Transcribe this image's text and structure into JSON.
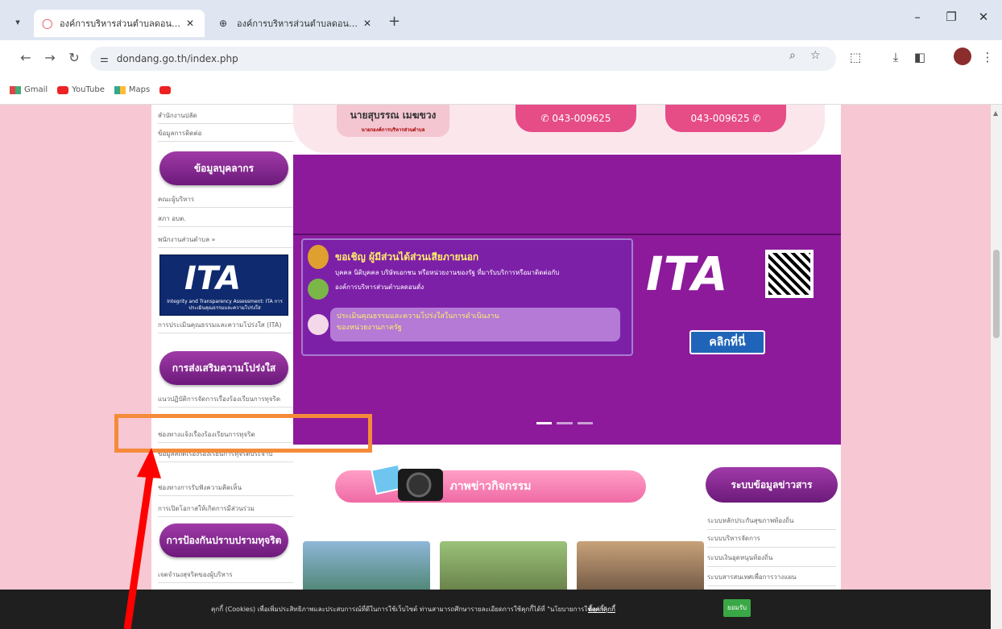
{
  "browser": {
    "tabs": [
      {
        "title": "องค์การบริหารส่วนตำบลดอนดั่ง อำเ...",
        "active": true
      },
      {
        "title": "องค์การบริหารส่วนตำบลดอนดั่ง อำเ...",
        "active": false
      }
    ],
    "url": "dondang.go.th/index.php",
    "bookmarks": [
      "Gmail",
      "YouTube",
      "Maps"
    ]
  },
  "colors": {
    "page_bg": "#f7c7d3",
    "purple": "#8d1a9b",
    "pink": "#e64c86",
    "annotation_box": "#f58b3a",
    "annotation_arrow": "#ff0000"
  },
  "sidebar": {
    "top_links": [
      "สำนักงานปลัด",
      "ข้อมูลการติดต่อ"
    ],
    "personnel_heading": "ข้อมูลบุคลากร",
    "personnel_links": [
      "คณะผู้บริหาร",
      "สภา อบต.",
      "พนักงานส่วนตำบล »"
    ],
    "ita": {
      "logo": "ITA",
      "caption": "Integrity and Transparency Assessment: ITA การประเมินคุณธรรมและความโปร่งใส",
      "link": "การประเมินคุณธรรมและความโปร่งใส (ITA)"
    },
    "transparency_heading": "การส่งเสริมความโปร่งใส",
    "transparency_links": [
      "แนวปฏิบัติการจัดการเรื่องร้องเรียนการทุจริต",
      "ช่องทางแจ้งเรื่องร้องเรียนการทุจริต",
      "ข้อมูลสถิติเรื่องร้องเรียนการทุจริตประจำปี",
      "ช่องทางการรับฟังความคิดเห็น",
      "การเปิดโอกาสให้เกิดการมีส่วนร่วม"
    ],
    "corruption_heading": "การป้องกันปราบปรามทุจริต",
    "corruption_links": [
      "เจตจำนงสุจริตของผู้บริหาร"
    ]
  },
  "header": {
    "name": "นายสุบรรณ เมฆขวง",
    "role": "นายกองค์การบริหารส่วนตำบล",
    "phone1": "043-009625",
    "phone2": "043-009625"
  },
  "slide": {
    "line1": "ขอเชิญ ผู้มีส่วนได้ส่วนเสียภายนอก",
    "line2": "บุคคล นิติบุคคล บริษัทเอกชน หรือหน่วยงานของรัฐ ที่มารับบริการหรือมาติดต่อกับ",
    "line3": "องค์การบริหารส่วนตำบลดอนดั่ง",
    "box_line1": "ประเมินคุณธรรมและความโปร่งใสในการดำเนินงาน",
    "box_line2": "ของหน่วยงานภาครัฐ",
    "ita_logo": "ITA",
    "click": "คลิกที่นี่"
  },
  "news": {
    "heading": "ภาพข่าวกิจกรรม"
  },
  "info": {
    "heading": "ระบบข้อมูลข่าวสาร",
    "links": [
      "ระบบหลักประกันสุขภาพท้องถิ่น",
      "ระบบบริหารจัดการ",
      "ระบบเงินอุดหนุนท้องถิ่น",
      "ระบบสารสนเทศเพื่อการวางแผน"
    ]
  },
  "cookie": {
    "text": "คุกกี้ (Cookies) เพื่อเพิ่มประสิทธิภาพและประสบการณ์ที่ดีในการใช้เว็บไซต์ ท่านสามารถศึกษารายละเอียดการใช้คุกกี้ได้ที่ \"นโยบายการใช้คุกกี้\"",
    "link": "ตั้งค่าคุกกี้",
    "accept": "ยอมรับ"
  }
}
